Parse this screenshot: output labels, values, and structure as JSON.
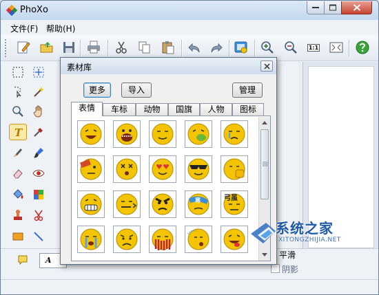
{
  "app": {
    "title": "PhoXo",
    "menu": [
      {
        "label": "文件(F)"
      },
      {
        "label": "帮助(H)"
      }
    ],
    "toolbar": {
      "actual_size_label": "1:1"
    }
  },
  "dialog": {
    "title": "素材库",
    "buttons": {
      "more": "更多",
      "import": "导入",
      "manage": "管理"
    },
    "tabs": [
      "表情",
      "车标",
      "动物",
      "国旗",
      "人物",
      "图标"
    ],
    "active_tab": "表情",
    "emoji_icons": [
      [
        "laughing-emoji",
        "shouting-emoji",
        "smiling-emoji",
        "eating-emoji",
        "crying-emoji"
      ],
      [
        "confused-emoji",
        "dizzy-emoji",
        "heart-eyes-emoji",
        "sunglasses-emoji",
        "fist-emoji"
      ],
      [
        "grinning-emoji",
        "arguing-emoji",
        "angry-emoji",
        "cold-emoji",
        "strong-emoji"
      ],
      [
        "tears-emoji",
        "sad-emoji",
        "bleeding-emoji",
        "sleepy-emoji",
        "tongue-emoji"
      ]
    ]
  },
  "text_options": {
    "font_sample": "A",
    "smooth_label": "平滑",
    "shadow_label": "阴影"
  },
  "watermark": {
    "title": "系统之家",
    "url": "XITONGZHIJIA.NET"
  },
  "colors": {
    "titlebar": "#c3d7ee",
    "close_button": "#c5432f",
    "emoji_yellow": "#f5c400",
    "watermark_blue": "#1f5aa6"
  }
}
